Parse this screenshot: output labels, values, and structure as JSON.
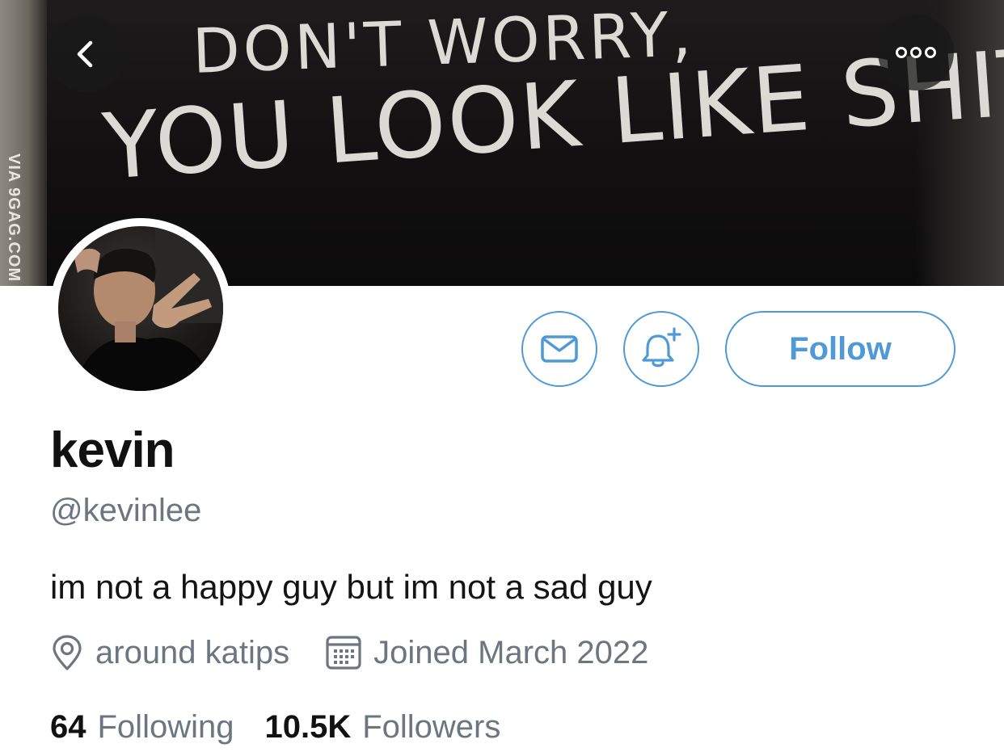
{
  "banner": {
    "line1": "DON'T WORRY,",
    "line2": "YOU LOOK LIKE SHIT",
    "watermark": "VIA 9GAG.COM"
  },
  "nav": {
    "back_icon": "chevron-left-icon",
    "more_icon": "more-dots-icon"
  },
  "profile": {
    "display_name": "kevin",
    "handle": "@kevinlee",
    "bio": "im not a happy guy but im not a sad guy",
    "location": "around katips",
    "joined": "Joined March 2022"
  },
  "actions": {
    "message_icon": "mail-icon",
    "notify_icon": "bell-plus-icon",
    "follow_label": "Follow"
  },
  "stats": {
    "following_count": "64",
    "following_label": "Following",
    "followers_count": "10.5K",
    "followers_label": "Followers"
  },
  "colors": {
    "accent": "#4f9ad6",
    "secondary_text": "#6c7680",
    "primary_text": "#111111"
  }
}
